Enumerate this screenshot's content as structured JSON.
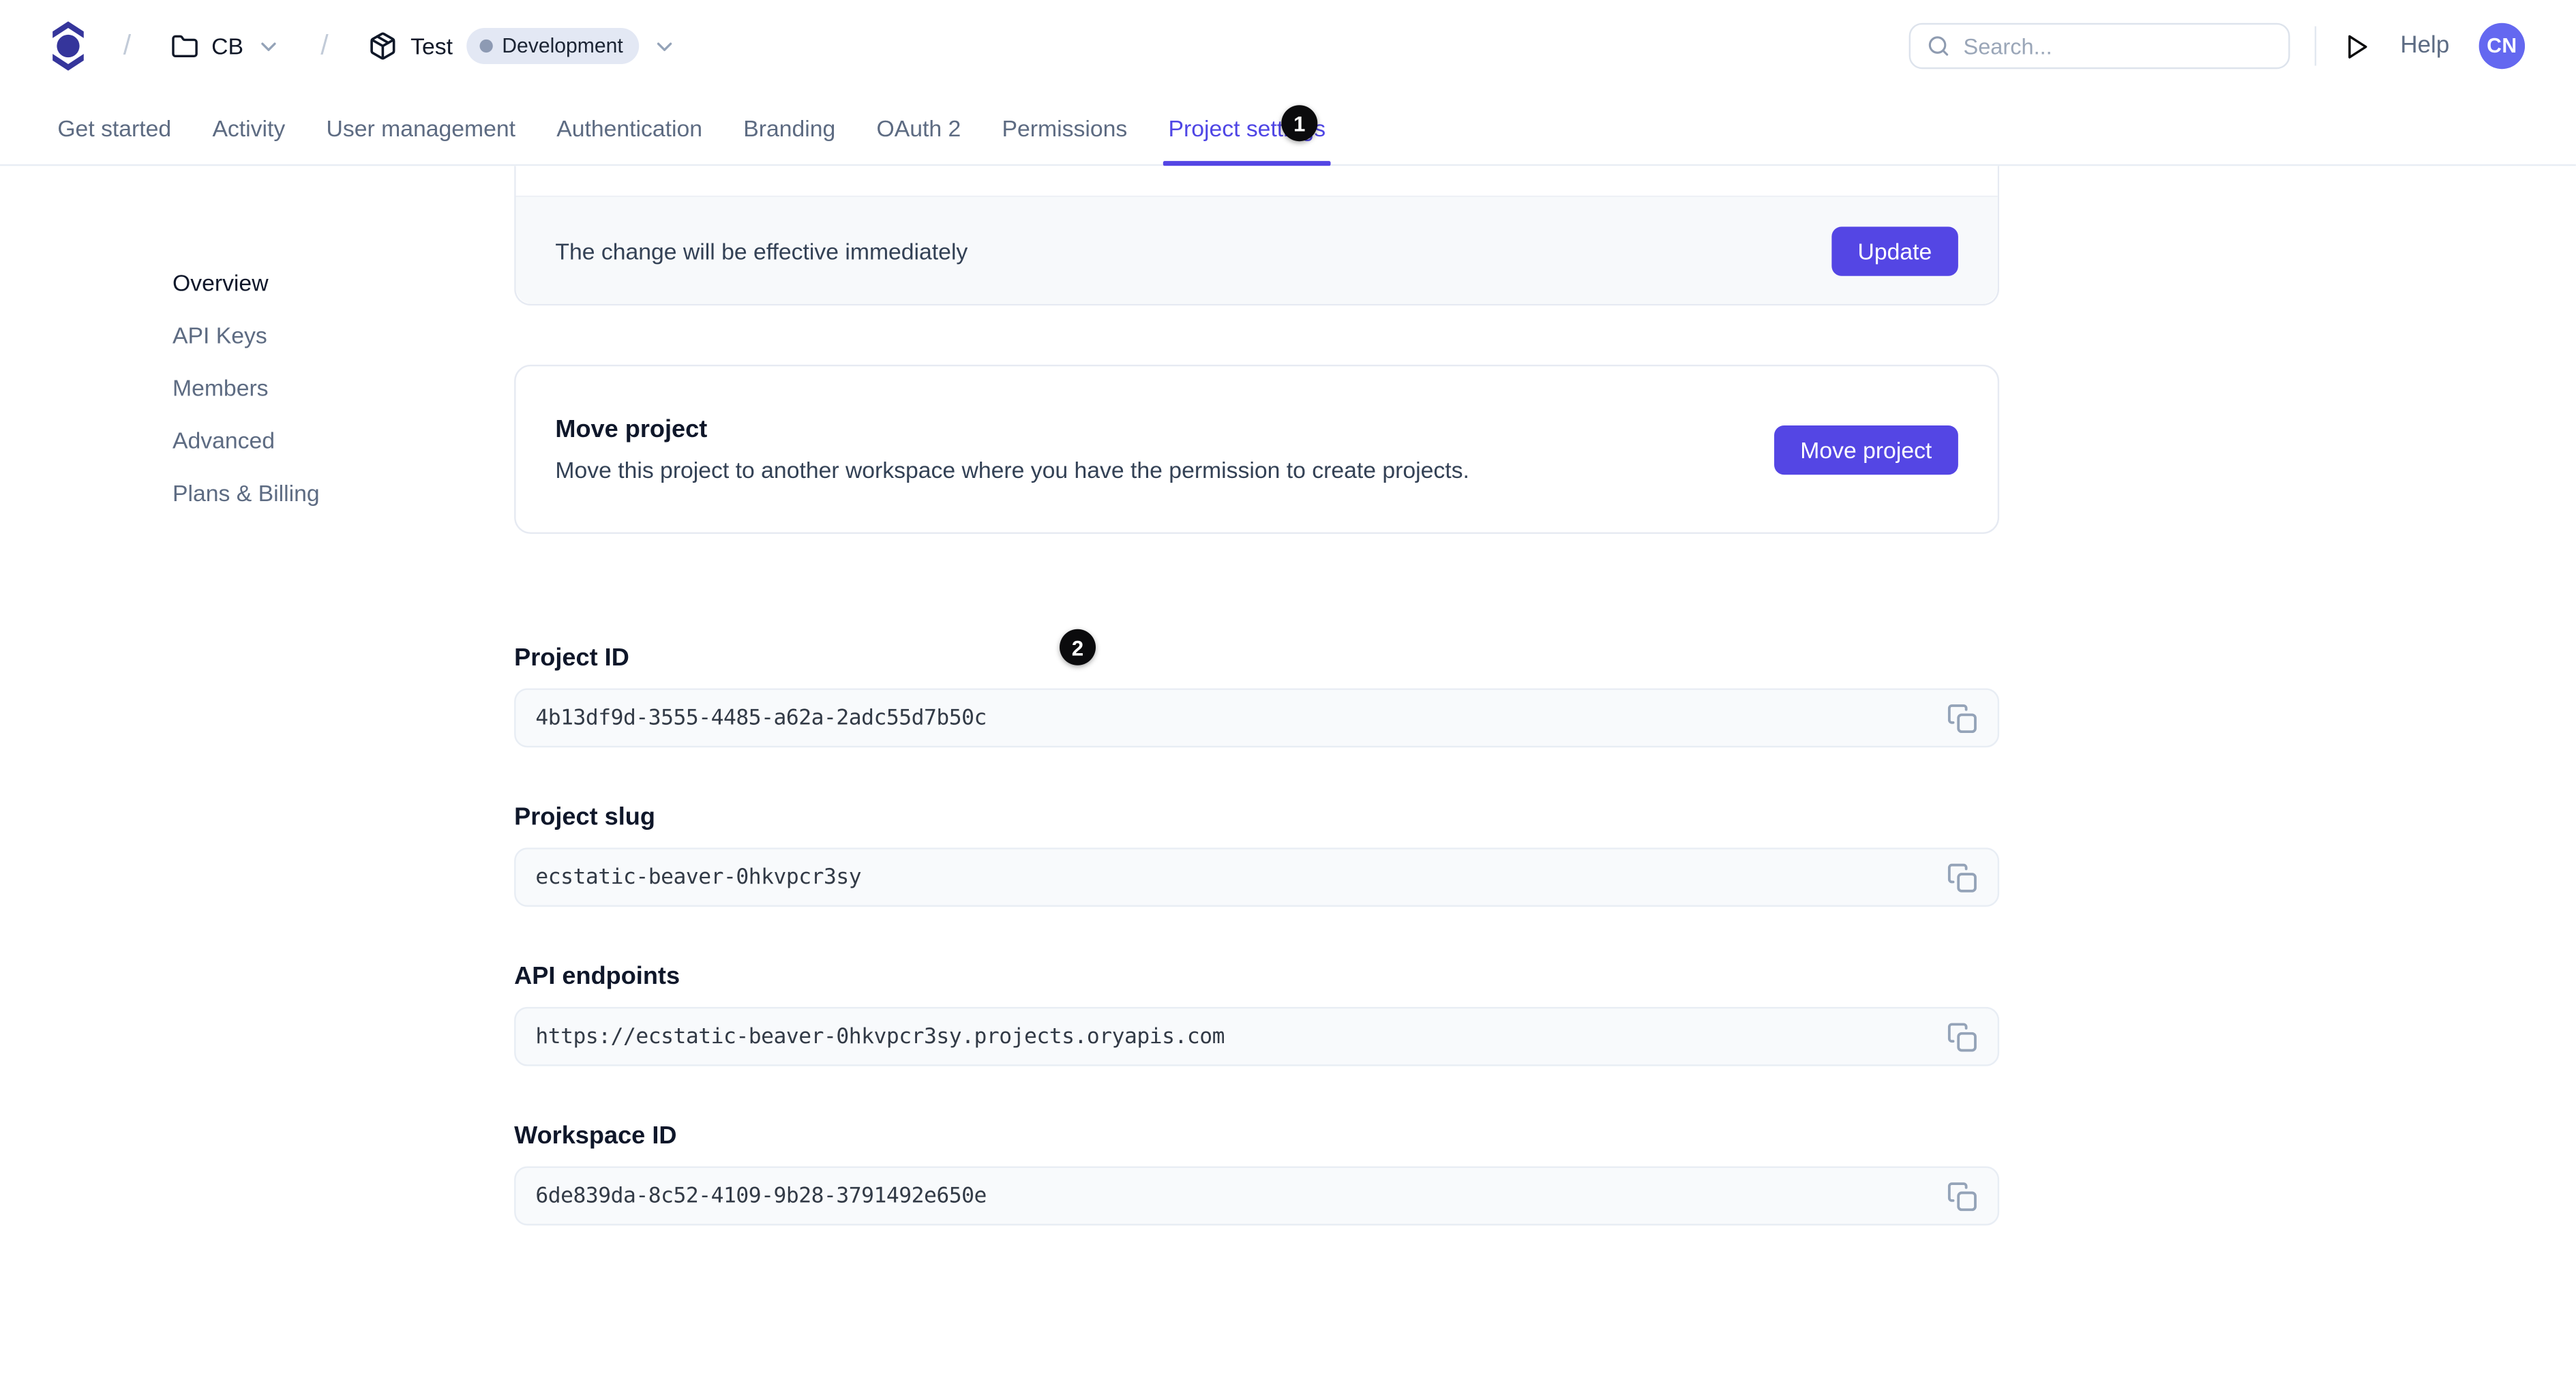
{
  "header": {
    "breadcrumb": {
      "separator": "/",
      "workspace": "CB",
      "project": "Test",
      "environment": "Development"
    },
    "search": {
      "placeholder": "Search..."
    },
    "help_label": "Help",
    "avatar_initials": "CN"
  },
  "tabs": [
    {
      "label": "Get started"
    },
    {
      "label": "Activity"
    },
    {
      "label": "User management"
    },
    {
      "label": "Authentication"
    },
    {
      "label": "Branding"
    },
    {
      "label": "OAuth 2"
    },
    {
      "label": "Permissions"
    },
    {
      "label": "Project settings",
      "active": true
    }
  ],
  "annotations": {
    "badge_1": "1",
    "badge_2": "2"
  },
  "sidebar": {
    "items": [
      {
        "label": "Overview",
        "active": true
      },
      {
        "label": "API Keys"
      },
      {
        "label": "Members"
      },
      {
        "label": "Advanced"
      },
      {
        "label": "Plans & Billing"
      }
    ]
  },
  "main": {
    "update_card": {
      "message": "The change will be effective immediately",
      "button": "Update"
    },
    "move_card": {
      "title": "Move project",
      "description": "Move this project to another workspace where you have the permission to create projects.",
      "button": "Move project"
    },
    "fields": [
      {
        "label": "Project ID",
        "value": "4b13df9d-3555-4485-a62a-2adc55d7b50c"
      },
      {
        "label": "Project slug",
        "value": "ecstatic-beaver-0hkvpcr3sy"
      },
      {
        "label": "API endpoints",
        "value": "https://ecstatic-beaver-0hkvpcr3sy.projects.oryapis.com"
      },
      {
        "label": "Workspace ID",
        "value": "6de839da-8c52-4109-9b28-3791492e650e"
      }
    ]
  },
  "colors": {
    "accent_indigo": "#5446E4",
    "active_tab": "#4F46E5",
    "logo_indigo": "#35359B",
    "avatar_bg": "#6468F0",
    "badge_black": "#0B0B0D",
    "env_badge_bg": "#E3E8F4",
    "env_badge_dot": "#8D9AB3",
    "input_bg": "#F8FAFC",
    "card_footer_bg": "#F7F9FB",
    "border": "#E6EAF2"
  }
}
